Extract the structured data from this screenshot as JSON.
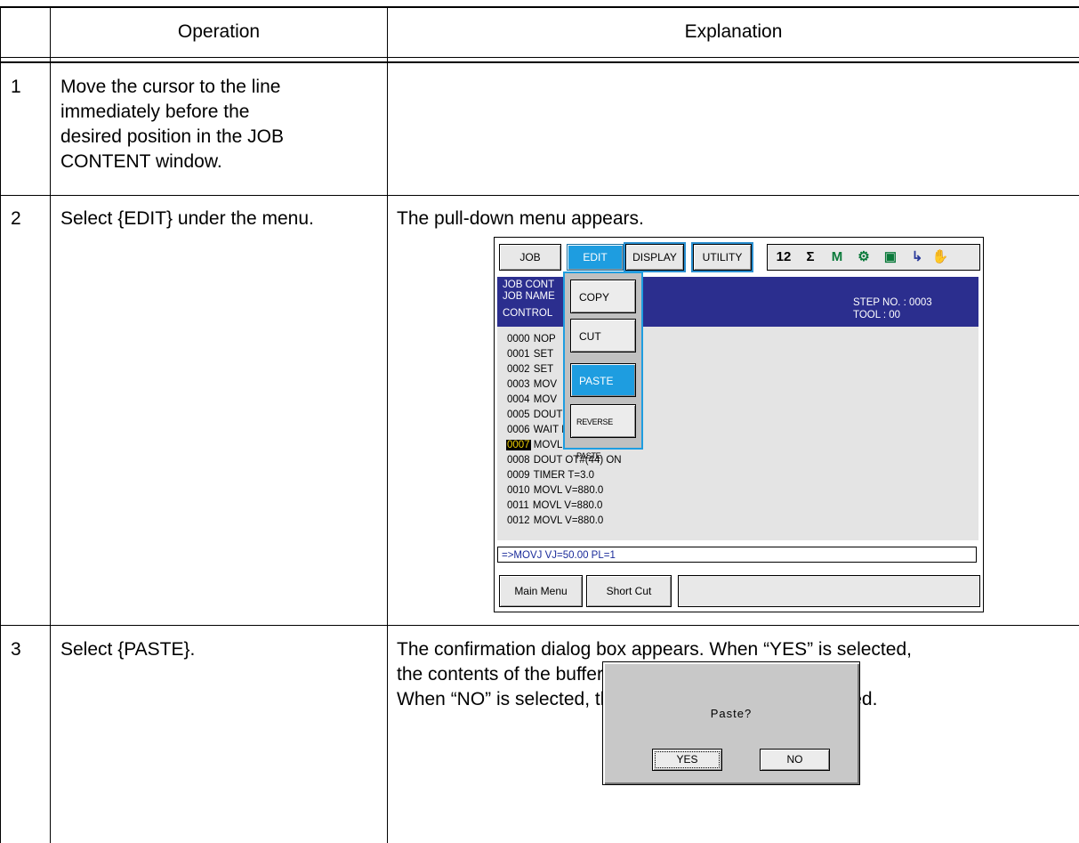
{
  "table": {
    "headers": {
      "operation": "Operation",
      "explanation": "Explanation"
    },
    "steps": [
      {
        "num": "1",
        "operation_lines": [
          "Move the cursor to the line",
          "immediately before the",
          "desired position in the JOB",
          "CONTENT window."
        ],
        "explanation_lines": []
      },
      {
        "num": "2",
        "operation_lines": [
          "Select {EDIT} under the menu."
        ],
        "explanation_lines": [
          "The pull-down menu appears."
        ]
      },
      {
        "num": "3",
        "operation_lines": [
          "Select {PASTE}."
        ],
        "explanation_lines": [
          "The confirmation dialog box appears.  When “YES” is selected,",
          "the contents of the buffer are inserted to the job.",
          "When “NO” is selected, the pasting operation is cancelled."
        ]
      }
    ]
  },
  "pendant": {
    "menu": {
      "job": "JOB",
      "edit": "EDIT",
      "display": "DISPLAY",
      "utility": "UTILITY"
    },
    "status_icons": [
      "12",
      "Σ",
      "M",
      "⚙",
      "▣",
      "↳",
      "✋"
    ],
    "title": {
      "job_content": "JOB CONT",
      "job_name": "JOB NAME",
      "control": "CONTROL",
      "step_no": "STEP NO. : 0003",
      "tool": "TOOL  :  00"
    },
    "dropdown": {
      "copy": "COPY",
      "cut": "CUT",
      "paste": "PASTE",
      "reverse_paste": "REVERSE PASTE"
    },
    "lines": [
      {
        "num": "0000",
        "text": " NOP"
      },
      {
        "num": "0001",
        "text": " SET"
      },
      {
        "num": "0002",
        "text": " SET"
      },
      {
        "num": "0003",
        "text": " MOV"
      },
      {
        "num": "0004",
        "text": " MOV"
      },
      {
        "num": "0005",
        "text": " DOUT OGH#(13) B002"
      },
      {
        "num": "0006",
        "text": " WAIT IF IN#(5)=ON"
      },
      {
        "num": "0007",
        "text": " MOVL V=880.0"
      },
      {
        "num": "0008",
        "text": " DOUT OT#(44) ON"
      },
      {
        "num": "0009",
        "text": " TIMER T=3.0"
      },
      {
        "num": "0010",
        "text": " MOVL V=880.0"
      },
      {
        "num": "0011",
        "text": " MOVL V=880.0"
      },
      {
        "num": "0012",
        "text": " MOVL V=880.0"
      }
    ],
    "cursor_line": "0007",
    "input_line": "=>MOVJ VJ=50.00 PL=1",
    "bottom": {
      "main_menu": "Main Menu",
      "short_cut": "Short Cut"
    }
  },
  "dialog": {
    "message": "Paste?",
    "yes": "YES",
    "no": "NO"
  }
}
